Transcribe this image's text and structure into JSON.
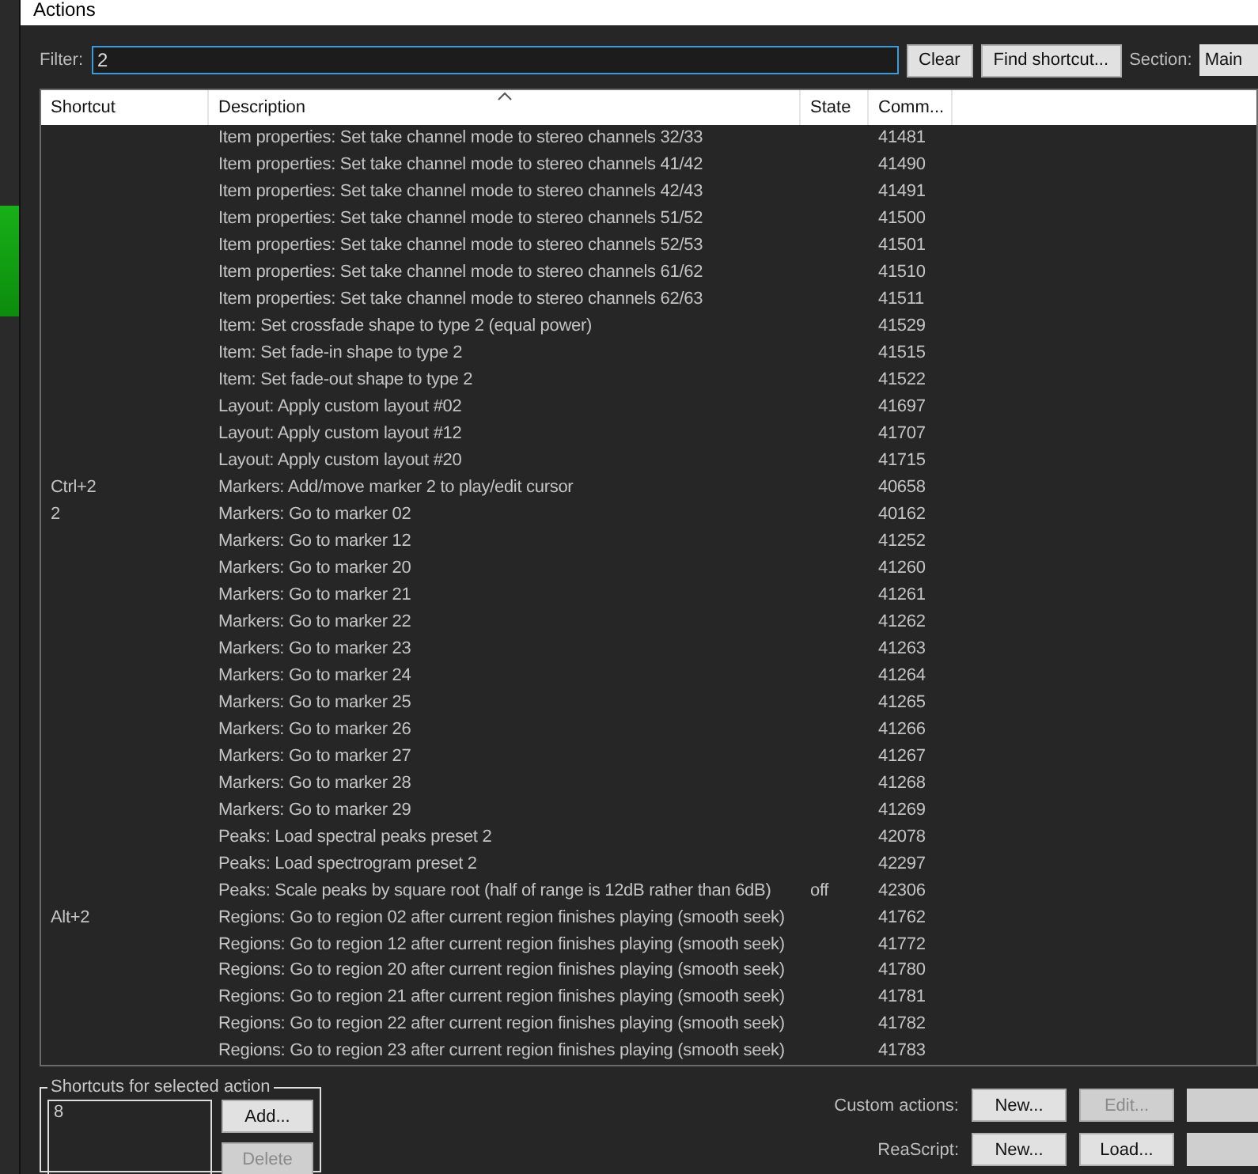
{
  "window": {
    "title": "Actions"
  },
  "filter": {
    "label": "Filter:",
    "value": "2"
  },
  "buttons": [
    {
      "label": "Clear"
    },
    {
      "label": "Find shortcut..."
    }
  ],
  "section": {
    "label": "Section:",
    "value": "Main"
  },
  "table": {
    "columns": [
      "Shortcut",
      "Description",
      "State",
      "Comm..."
    ],
    "rows": [
      {
        "shortcut": "",
        "description": "Item properties: Set take channel mode to stereo channels 32/33",
        "state": "",
        "command": "41481"
      },
      {
        "shortcut": "",
        "description": "Item properties: Set take channel mode to stereo channels 41/42",
        "state": "",
        "command": "41490"
      },
      {
        "shortcut": "",
        "description": "Item properties: Set take channel mode to stereo channels 42/43",
        "state": "",
        "command": "41491"
      },
      {
        "shortcut": "",
        "description": "Item properties: Set take channel mode to stereo channels 51/52",
        "state": "",
        "command": "41500"
      },
      {
        "shortcut": "",
        "description": "Item properties: Set take channel mode to stereo channels 52/53",
        "state": "",
        "command": "41501"
      },
      {
        "shortcut": "",
        "description": "Item properties: Set take channel mode to stereo channels 61/62",
        "state": "",
        "command": "41510"
      },
      {
        "shortcut": "",
        "description": "Item properties: Set take channel mode to stereo channels 62/63",
        "state": "",
        "command": "41511"
      },
      {
        "shortcut": "",
        "description": "Item: Set crossfade shape to type 2 (equal power)",
        "state": "",
        "command": "41529"
      },
      {
        "shortcut": "",
        "description": "Item: Set fade-in shape to type 2",
        "state": "",
        "command": "41515"
      },
      {
        "shortcut": "",
        "description": "Item: Set fade-out shape to type 2",
        "state": "",
        "command": "41522"
      },
      {
        "shortcut": "",
        "description": "Layout: Apply custom layout #02",
        "state": "",
        "command": "41697"
      },
      {
        "shortcut": "",
        "description": "Layout: Apply custom layout #12",
        "state": "",
        "command": "41707"
      },
      {
        "shortcut": "",
        "description": "Layout: Apply custom layout #20",
        "state": "",
        "command": "41715"
      },
      {
        "shortcut": "Ctrl+2",
        "description": "Markers: Add/move marker 2 to play/edit cursor",
        "state": "",
        "command": "40658"
      },
      {
        "shortcut": "2",
        "description": "Markers: Go to marker 02",
        "state": "",
        "command": "40162"
      },
      {
        "shortcut": "",
        "description": "Markers: Go to marker 12",
        "state": "",
        "command": "41252"
      },
      {
        "shortcut": "",
        "description": "Markers: Go to marker 20",
        "state": "",
        "command": "41260"
      },
      {
        "shortcut": "",
        "description": "Markers: Go to marker 21",
        "state": "",
        "command": "41261"
      },
      {
        "shortcut": "",
        "description": "Markers: Go to marker 22",
        "state": "",
        "command": "41262"
      },
      {
        "shortcut": "",
        "description": "Markers: Go to marker 23",
        "state": "",
        "command": "41263"
      },
      {
        "shortcut": "",
        "description": "Markers: Go to marker 24",
        "state": "",
        "command": "41264"
      },
      {
        "shortcut": "",
        "description": "Markers: Go to marker 25",
        "state": "",
        "command": "41265"
      },
      {
        "shortcut": "",
        "description": "Markers: Go to marker 26",
        "state": "",
        "command": "41266"
      },
      {
        "shortcut": "",
        "description": "Markers: Go to marker 27",
        "state": "",
        "command": "41267"
      },
      {
        "shortcut": "",
        "description": "Markers: Go to marker 28",
        "state": "",
        "command": "41268"
      },
      {
        "shortcut": "",
        "description": "Markers: Go to marker 29",
        "state": "",
        "command": "41269"
      },
      {
        "shortcut": "",
        "description": "Peaks: Load spectral peaks preset 2",
        "state": "",
        "command": "42078"
      },
      {
        "shortcut": "",
        "description": "Peaks: Load spectrogram preset 2",
        "state": "",
        "command": "42297"
      },
      {
        "shortcut": "",
        "description": "Peaks: Scale peaks by square root (half of range is 12dB rather than 6dB)",
        "state": "off",
        "command": "42306"
      },
      {
        "shortcut": "Alt+2",
        "description": "Regions: Go to region 02 after current region finishes playing (smooth seek)",
        "state": "",
        "command": "41762"
      },
      {
        "shortcut": "",
        "description": "Regions: Go to region 12 after current region finishes playing (smooth seek)",
        "state": "",
        "command": "41772"
      },
      {
        "shortcut": "",
        "description": "Regions: Go to region 20 after current region finishes playing (smooth seek)",
        "state": "",
        "command": "41780"
      },
      {
        "shortcut": "",
        "description": "Regions: Go to region 21 after current region finishes playing (smooth seek)",
        "state": "",
        "command": "41781"
      },
      {
        "shortcut": "",
        "description": "Regions: Go to region 22 after current region finishes playing (smooth seek)",
        "state": "",
        "command": "41782"
      },
      {
        "shortcut": "",
        "description": "Regions: Go to region 23 after current region finishes playing (smooth seek)",
        "state": "",
        "command": "41783"
      }
    ]
  },
  "shortcuts_group": {
    "title": "Shortcuts for selected action",
    "items": [
      "8"
    ],
    "buttons": [
      {
        "label": "Add...",
        "disabled": false
      },
      {
        "label": "Delete",
        "disabled": true
      }
    ]
  },
  "custom_actions": {
    "label": "Custom actions:",
    "buttons": [
      {
        "label": "New...",
        "disabled": false
      },
      {
        "label": "Edit...",
        "disabled": true
      }
    ]
  },
  "reascript": {
    "label": "ReaScript:",
    "buttons": [
      {
        "label": "New...",
        "disabled": false
      },
      {
        "label": "Load...",
        "disabled": false
      }
    ]
  }
}
